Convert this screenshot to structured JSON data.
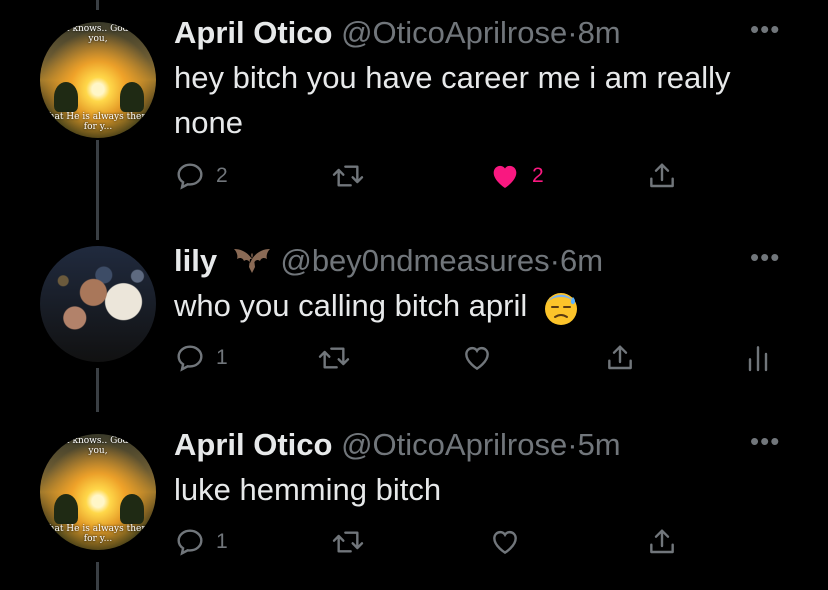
{
  "tweets": [
    {
      "name": "April Otico",
      "handle": "@OticoAprilrose",
      "separator": "·",
      "time": "8m",
      "text": "hey bitch you have career me i am really none",
      "avatar": {
        "top_text": "...man knows.. God loves you,",
        "bottom_text": "that He is always there for y..."
      },
      "replies": "2",
      "likes": "2",
      "liked": true
    },
    {
      "name": "lily",
      "handle": "@bey0ndmeasures",
      "separator": "·",
      "time": "6m",
      "text": "who you calling bitch april",
      "name_emoji": "bat",
      "text_emoji": "downcast-face-with-sweat",
      "replies": "1",
      "liked": false
    },
    {
      "name": "April Otico",
      "handle": "@OticoAprilrose",
      "separator": "·",
      "time": "5m",
      "text": "luke hemming bitch",
      "avatar": {
        "top_text": "...man knows.. God loves you,",
        "bottom_text": "that He is always there for y..."
      },
      "replies": "1",
      "liked": false
    }
  ],
  "more_label": "•••",
  "icons": {
    "reply": "reply-icon",
    "retweet": "retweet-icon",
    "like": "heart-icon",
    "share": "share-icon",
    "analytics": "analytics-icon",
    "more": "more-icon"
  },
  "colors": {
    "like": "#f91880",
    "muted": "#71767b",
    "thread_line": "#3a3f44"
  }
}
